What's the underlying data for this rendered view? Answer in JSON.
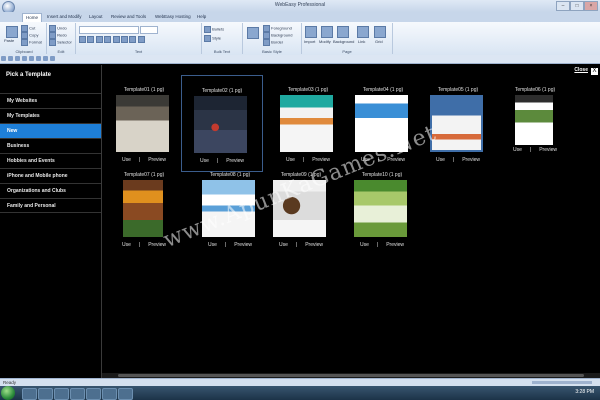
{
  "window": {
    "title": "WebEasy Professional",
    "controls": [
      "–",
      "□",
      "×"
    ]
  },
  "tabs": [
    "Home",
    "Insert and Modify",
    "Layout",
    "Review and Tools",
    "WebEasy Hosting",
    "Help"
  ],
  "ribbon": {
    "groups": [
      "Clipboard",
      "Edit",
      "Text",
      "Bulk Text",
      "Basic Style",
      "Page"
    ],
    "clipboard": {
      "paste": "Paste",
      "cut": "Cut",
      "copy": "Copy",
      "format": "Format"
    },
    "edit": {
      "undo": "Undo",
      "redo": "Redo",
      "selector": "Selector"
    },
    "bulk": {
      "bullets": "Bullets",
      "style": "Style"
    },
    "basic_style": {
      "foreground": "Foreground",
      "background": "Background",
      "border": "Border"
    },
    "page": {
      "import": "Import",
      "modify": "Modify",
      "background": "Background",
      "link": "Link",
      "grid": "Grid"
    }
  },
  "sidebar": {
    "heading": "Pick a Template",
    "items": [
      "My Websites",
      "My Templates",
      "New",
      "Business",
      "Hobbies and Events",
      "iPhone and Mobile phone",
      "Organizations and Clubs",
      "Family and Personal"
    ],
    "selected_index": 2
  },
  "dialog": {
    "close_label": "Close",
    "close_box": "X"
  },
  "templates": [
    {
      "name": "Template01 (1 pg)",
      "use": "Use",
      "preview": "Preview",
      "sep": "|"
    },
    {
      "name": "Template02 (1 pg)",
      "use": "Use",
      "preview": "Preview",
      "sep": "|"
    },
    {
      "name": "Template03 (1 pg)",
      "use": "Use",
      "preview": "Preview",
      "sep": "|"
    },
    {
      "name": "Template04 (1 pg)",
      "use": "Use",
      "preview": "Preview",
      "sep": "|"
    },
    {
      "name": "Template05 (1 pg)",
      "use": "Use",
      "preview": "Preview",
      "sep": "|"
    },
    {
      "name": "Template06 (1 pg)",
      "use": "Use",
      "preview": "Preview",
      "sep": "|"
    },
    {
      "name": "Template07 (1 pg)",
      "use": "Use",
      "preview": "Preview",
      "sep": "|"
    },
    {
      "name": "Template08 (1 pg)",
      "use": "Use",
      "preview": "Preview",
      "sep": "|"
    },
    {
      "name": "Template09 (1 pg)",
      "use": "Use",
      "preview": "Preview",
      "sep": "|"
    },
    {
      "name": "Template10 (1 pg)",
      "use": "Use",
      "preview": "Preview",
      "sep": "|"
    }
  ],
  "status": {
    "text": "Ready"
  },
  "taskbar": {
    "clock": "3:28 PM"
  },
  "watermark": "www.ApunKaGames.Net"
}
